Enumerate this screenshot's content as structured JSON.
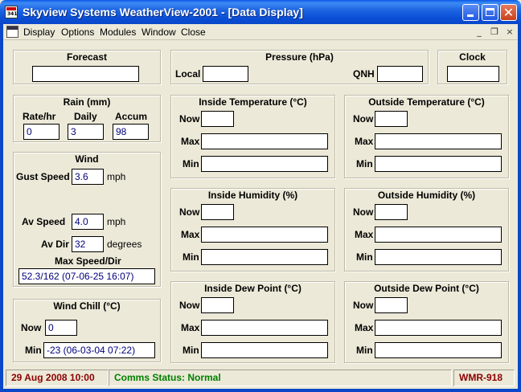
{
  "window": {
    "title": "Skyview Systems WeatherView-2001 - [Data Display]",
    "icon": "app-weather-icon"
  },
  "menu": {
    "items": [
      "Display",
      "Options",
      "Modules",
      "Window",
      "Close"
    ]
  },
  "mdi_controls": {
    "minimize": "_",
    "restore": "❐",
    "close": "×"
  },
  "forecast": {
    "title": "Forecast",
    "value": ""
  },
  "pressure": {
    "title": "Pressure (hPa)",
    "local_label": "Local",
    "local_value": "",
    "qnh_label": "QNH",
    "qnh_value": ""
  },
  "clock": {
    "title": "Clock",
    "value": ""
  },
  "rain": {
    "title": "Rain (mm)",
    "rate_label": "Rate/hr",
    "rate_value": "0",
    "daily_label": "Daily",
    "daily_value": "3",
    "accum_label": "Accum",
    "accum_value": "98"
  },
  "wind": {
    "title": "Wind",
    "gust_label": "Gust Speed",
    "gust_value": "3.6",
    "gust_unit": "mph",
    "avspeed_label": "Av Speed",
    "avspeed_value": "4.0",
    "avspeed_unit": "mph",
    "avdir_label": "Av Dir",
    "avdir_value": "32",
    "avdir_unit": "degrees",
    "max_label": "Max Speed/Dir",
    "max_value": "52.3/162 (07-06-25 16:07)"
  },
  "windchill": {
    "title": "Wind Chill (°C)",
    "now_label": "Now",
    "now_value": "0",
    "min_label": "Min",
    "min_value": "-23 (06-03-04 07:22)"
  },
  "panels": {
    "inside_temp": {
      "title": "Inside Temperature (°C)",
      "now": "",
      "max": "",
      "min": ""
    },
    "outside_temp": {
      "title": "Outside Temperature (°C)",
      "now": "",
      "max": "",
      "min": ""
    },
    "inside_hum": {
      "title": "Inside Humidity (%)",
      "now": "",
      "max": "",
      "min": ""
    },
    "outside_hum": {
      "title": "Outside Humidity (%)",
      "now": "",
      "max": "",
      "min": ""
    },
    "inside_dew": {
      "title": "Inside Dew Point (°C)",
      "now": "",
      "max": "",
      "min": ""
    },
    "outside_dew": {
      "title": "Outside Dew Point (°C)",
      "now": "",
      "max": "",
      "min": ""
    }
  },
  "row_labels": {
    "now": "Now",
    "max": "Max",
    "min": "Min"
  },
  "status": {
    "datetime": "29 Aug 2008 10:00",
    "comms": "Comms Status: Normal",
    "station": "WMR-918",
    "datetime_color": "#8B0000",
    "comms_color": "#008000",
    "station_color": "#8B0000"
  }
}
